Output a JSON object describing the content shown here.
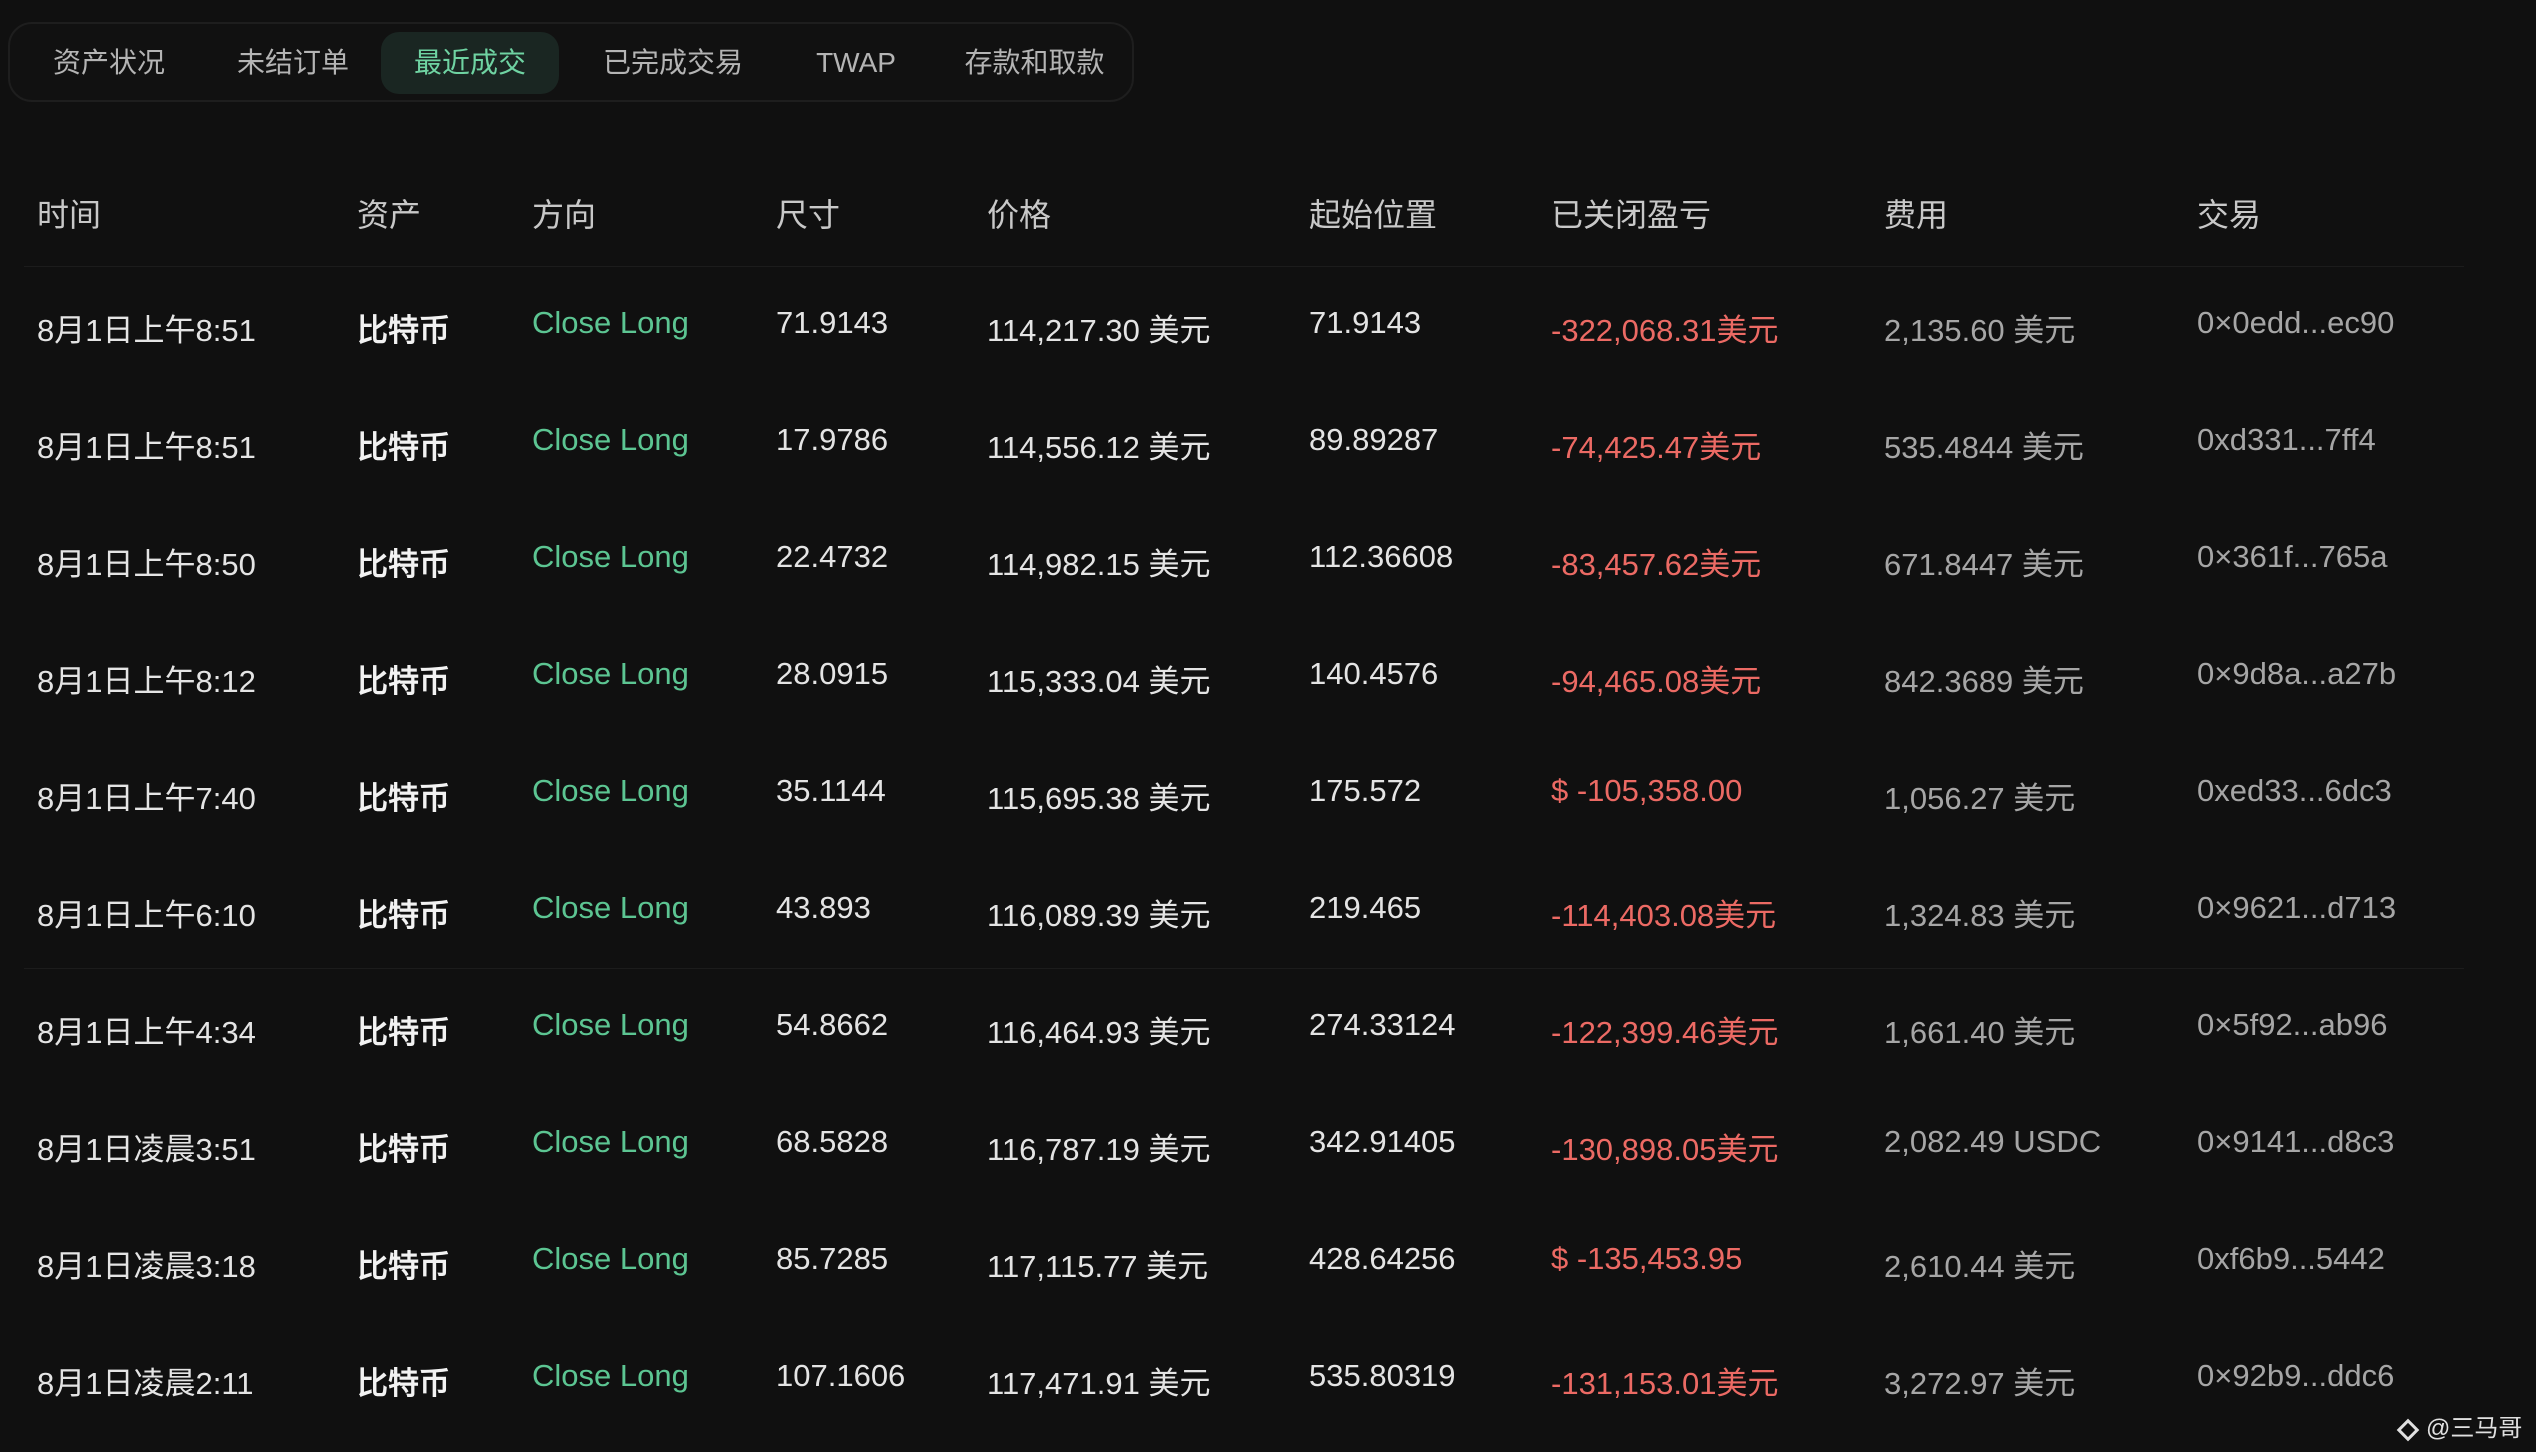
{
  "tabs": [
    {
      "label": "资产状况"
    },
    {
      "label": "未结订单"
    },
    {
      "label": "最近成交",
      "active": true
    },
    {
      "label": "已完成交易"
    },
    {
      "label": "TWAP"
    },
    {
      "label": "存款和取款"
    }
  ],
  "table": {
    "columns": [
      "时间",
      "资产",
      "方向",
      "尺寸",
      "价格",
      "起始位置",
      "已关闭盈亏",
      "费用",
      "交易"
    ],
    "rows": [
      {
        "time": "8月1日上午8:51",
        "asset": "比特币",
        "direction": "Close Long",
        "size": "71.9143",
        "price": "114,217.30 美元",
        "start_position": "71.9143",
        "closed_pnl": "-322,068.31美元",
        "fee": "2,135.60 美元",
        "tx": "0×0edd...ec90"
      },
      {
        "time": "8月1日上午8:51",
        "asset": "比特币",
        "direction": "Close Long",
        "size": "17.9786",
        "price": "114,556.12 美元",
        "start_position": "89.89287",
        "closed_pnl": "-74,425.47美元",
        "fee": "535.4844 美元",
        "tx": "0xd331...7ff4"
      },
      {
        "time": "8月1日上午8:50",
        "asset": "比特币",
        "direction": "Close Long",
        "size": "22.4732",
        "price": "114,982.15 美元",
        "start_position": "112.36608",
        "closed_pnl": "-83,457.62美元",
        "fee": "671.8447 美元",
        "tx": "0×361f...765a"
      },
      {
        "time": "8月1日上午8:12",
        "asset": "比特币",
        "direction": "Close Long",
        "size": "28.0915",
        "price": "115,333.04 美元",
        "start_position": "140.4576",
        "closed_pnl": "-94,465.08美元",
        "fee": "842.3689 美元",
        "tx": "0×9d8a...a27b"
      },
      {
        "time": "8月1日上午7:40",
        "asset": "比特币",
        "direction": "Close Long",
        "size": "35.1144",
        "price": "115,695.38 美元",
        "start_position": "175.572",
        "closed_pnl": "$ -105,358.00",
        "fee": "1,056.27 美元",
        "tx": "0xed33...6dc3"
      },
      {
        "time": "8月1日上午6:10",
        "asset": "比特币",
        "direction": "Close Long",
        "size": "43.893",
        "price": "116,089.39 美元",
        "start_position": "219.465",
        "closed_pnl": "-114,403.08美元",
        "fee": "1,324.83 美元",
        "tx": "0×9621...d713"
      },
      {
        "time": "8月1日上午4:34",
        "asset": "比特币",
        "direction": "Close Long",
        "size": "54.8662",
        "price": "116,464.93 美元",
        "start_position": "274.33124",
        "closed_pnl": "-122,399.46美元",
        "fee": "1,661.40 美元",
        "tx": "0×5f92...ab96"
      },
      {
        "time": "8月1日凌晨3:51",
        "asset": "比特币",
        "direction": "Close Long",
        "size": "68.5828",
        "price": "116,787.19 美元",
        "start_position": "342.91405",
        "closed_pnl": "-130,898.05美元",
        "fee": "2,082.49 USDC",
        "tx": "0×9141...d8c3"
      },
      {
        "time": "8月1日凌晨3:18",
        "asset": "比特币",
        "direction": "Close Long",
        "size": "85.7285",
        "price": "117,115.77 美元",
        "start_position": "428.64256",
        "closed_pnl": "$ -135,453.95",
        "fee": "2,610.44 美元",
        "tx": "0xf6b9...5442"
      },
      {
        "time": "8月1日凌晨2:11",
        "asset": "比特币",
        "direction": "Close Long",
        "size": "107.1606",
        "price": "117,471.91 美元",
        "start_position": "535.80319",
        "closed_pnl": "-131,153.01美元",
        "fee": "3,272.97 美元",
        "tx": "0×92b9...ddc6"
      }
    ]
  },
  "watermark": {
    "text": "@三马哥",
    "icon": "diamond-logo-icon"
  },
  "colors": {
    "background": "#101010",
    "active_tab_text": "#6fd3a2",
    "direction_green": "#5cc592",
    "pnl_red": "#ec6a64"
  }
}
